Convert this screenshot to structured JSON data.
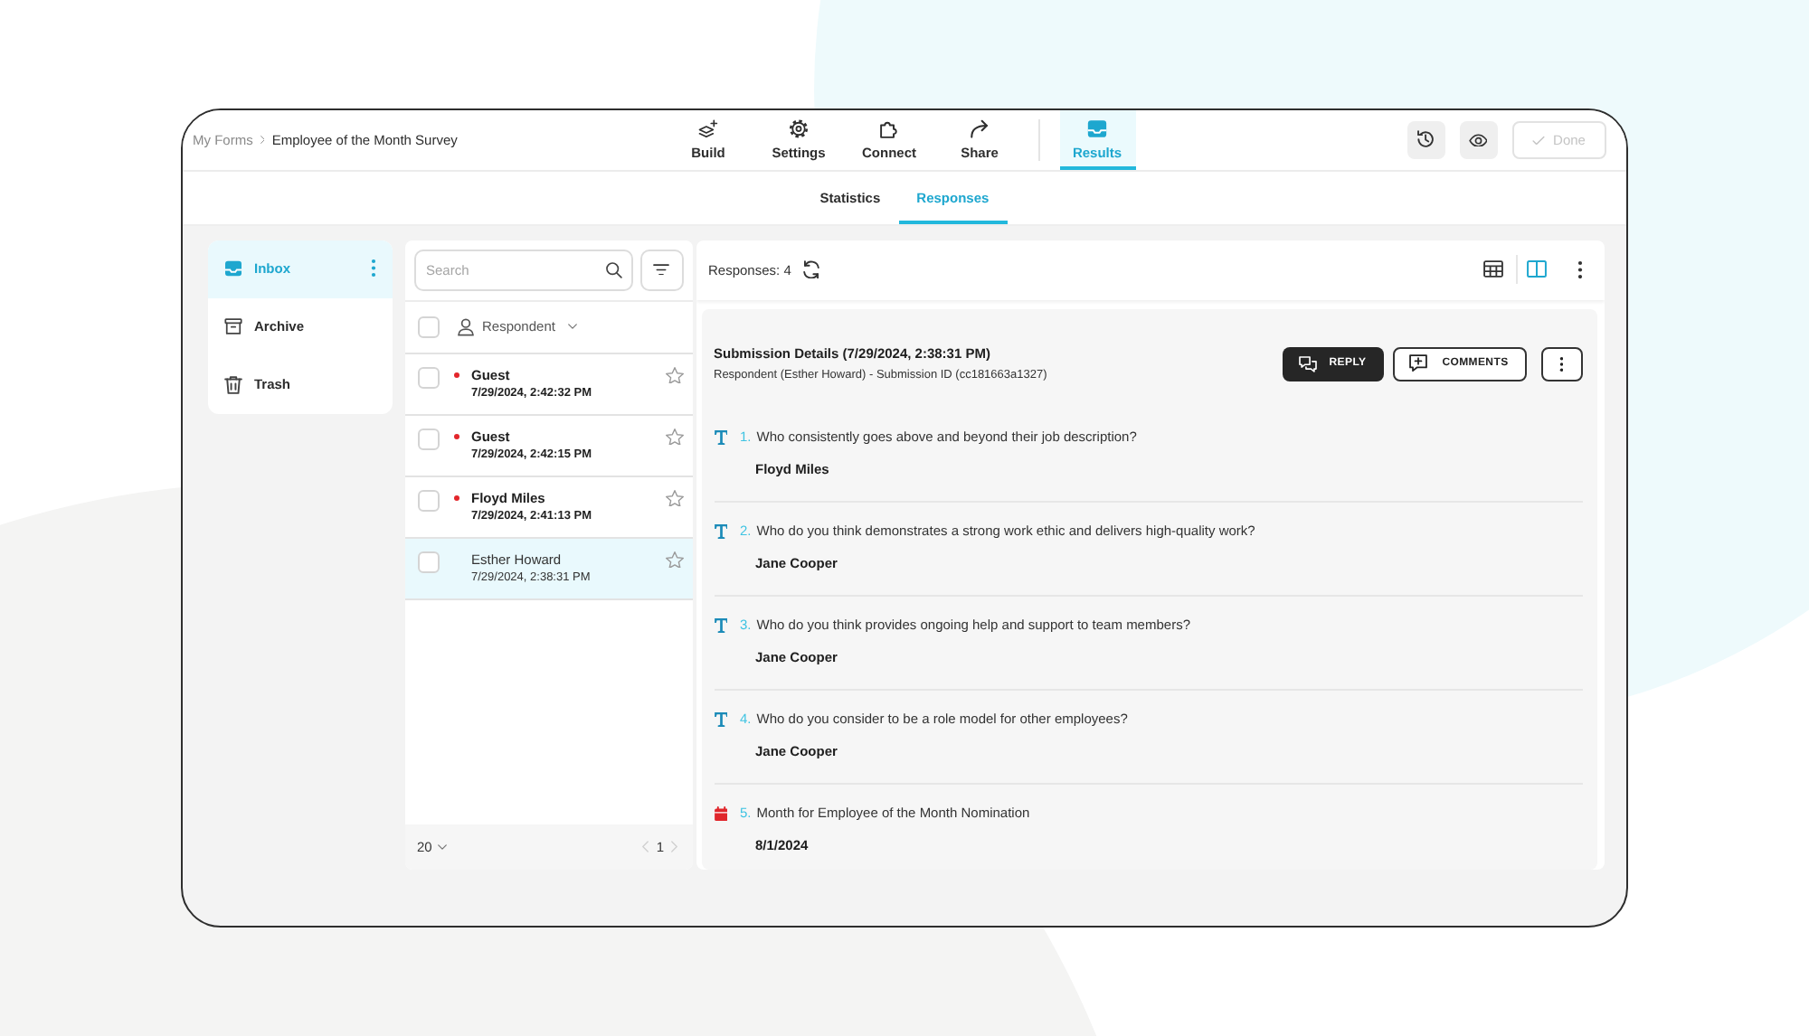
{
  "header": {
    "breadcrumb": [
      "My Forms",
      "Employee of the Month Survey"
    ],
    "nav": [
      {
        "label": "Build",
        "selected": false
      },
      {
        "label": "Settings",
        "selected": false
      },
      {
        "label": "Connect",
        "selected": false
      },
      {
        "label": "Share",
        "selected": false
      },
      {
        "label": "Results",
        "selected": true
      }
    ],
    "done_button": {
      "label": "Done",
      "disabled": true
    }
  },
  "subtabs": [
    {
      "label": "Statistics",
      "selected": false
    },
    {
      "label": "Responses",
      "selected": true
    }
  ],
  "folders": [
    {
      "label": "Inbox",
      "selected": true
    },
    {
      "label": "Archive",
      "selected": false
    },
    {
      "label": "Trash",
      "selected": false
    }
  ],
  "response_list": {
    "search": {
      "placeholder": "Search"
    },
    "select_all_checked": false,
    "column": "Respondent",
    "rows": [
      {
        "name": "Guest",
        "time": "7/29/2024, 2:42:32 PM",
        "unread": true,
        "starred": false,
        "checked": false,
        "selected": false
      },
      {
        "name": "Guest",
        "time": "7/29/2024, 2:42:15 PM",
        "unread": true,
        "starred": false,
        "checked": false,
        "selected": false
      },
      {
        "name": "Floyd Miles",
        "time": "7/29/2024, 2:41:13 PM",
        "unread": true,
        "starred": false,
        "checked": false,
        "selected": false
      },
      {
        "name": "Esther Howard",
        "time": "7/29/2024, 2:38:31 PM",
        "unread": false,
        "starred": false,
        "checked": false,
        "selected": true
      }
    ],
    "page_size": "20",
    "page": "1"
  },
  "detail": {
    "count_label": "Responses: 4",
    "views": [
      {
        "kind": "table",
        "selected": false
      },
      {
        "kind": "split",
        "selected": true
      }
    ],
    "submission": {
      "title": "Submission Details (7/29/2024, 2:38:31 PM)",
      "subtitle": "Respondent (Esther Howard) - Submission ID (cc181663a1327)",
      "reply_label": "REPLY",
      "comments_label": "COMMENTS"
    },
    "questions": [
      {
        "kind": "text",
        "number": "1.",
        "text": "Who consistently goes above and beyond their job description?",
        "answer": "Floyd Miles"
      },
      {
        "kind": "text",
        "number": "2.",
        "text": "Who do you think demonstrates a strong work ethic and delivers high-quality work?",
        "answer": "Jane Cooper"
      },
      {
        "kind": "text",
        "number": "3.",
        "text": "Who do you think provides ongoing help and support to team members?",
        "answer": "Jane Cooper"
      },
      {
        "kind": "text",
        "number": "4.",
        "text": "Who do you consider to be a role model for other employees?",
        "answer": "Jane Cooper"
      },
      {
        "kind": "date",
        "number": "5.",
        "text": "Month for Employee of the Month Nomination",
        "answer": "8/1/2024"
      }
    ]
  }
}
